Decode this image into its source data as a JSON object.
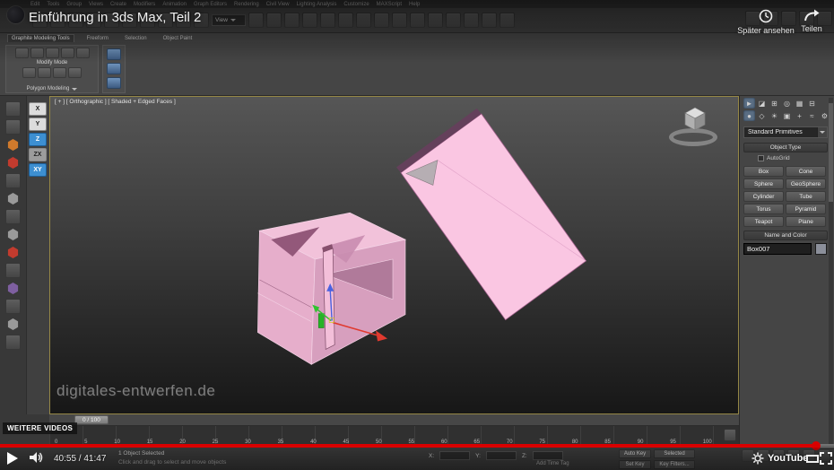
{
  "theme": {
    "yt_red": "#d90000",
    "object_pink": "#f2c2da",
    "object_pink_bright": "#fac6e2",
    "axis_blue": "#3d8fd1",
    "viewport_top": "#565656",
    "viewport_bottom": "#171717"
  },
  "player": {
    "title": "Einführung in 3ds Max, Teil 2",
    "watch_later_label": "Später ansehen",
    "share_label": "Teilen",
    "more_videos_label": "WEITERE VIDEOS",
    "time_display": "40:55 / 41:47",
    "progress_percent": 98,
    "brand": "YouTube"
  },
  "max_ui": {
    "menu_items": [
      "Edit",
      "Tools",
      "Group",
      "Views",
      "Create",
      "Modifiers",
      "Animation",
      "Graph Editors",
      "Rendering",
      "Civil View",
      "Lighting Analysis",
      "Customize",
      "MAXScript",
      "Help"
    ],
    "toolbar_view_label": "View",
    "ribbon_tabs": [
      "Graphite Modeling Tools",
      "Freeform",
      "Selection",
      "Object Paint"
    ],
    "modify_mode_label": "Modify Mode",
    "polygon_modeling_label": "Polygon Modeling",
    "viewport_label": "[ + ] [ Orthographic ] [ Shaded + Edged Faces ]",
    "axis_buttons": [
      "X",
      "Y",
      "Z",
      "ZX",
      "XY"
    ],
    "watermark": "digitales-entwerfen.de",
    "command_panel": {
      "category_dropdown": "Standard Primitives",
      "object_type_rollout": "Object Type",
      "autogrid_label": "AutoGrid",
      "primitive_buttons": [
        "Box",
        "Cone",
        "Sphere",
        "GeoSphere",
        "Cylinder",
        "Tube",
        "Torus",
        "Pyramid",
        "Teapot",
        "Plane"
      ],
      "name_color_rollout": "Name and Color",
      "object_name": "Box007"
    },
    "timeline": {
      "slider_label": "0 / 100",
      "ticks": [
        "0",
        "5",
        "10",
        "15",
        "20",
        "25",
        "30",
        "35",
        "40",
        "45",
        "50",
        "55",
        "60",
        "65",
        "70",
        "75",
        "80",
        "85",
        "90",
        "95",
        "100"
      ]
    },
    "status_bar": {
      "selection_status": "1 Object Selected",
      "hint": "Click and drag to select and move objects",
      "coord_labels": [
        "X:",
        "Y:",
        "Z:"
      ],
      "add_time_tag": "Add Time Tag",
      "auto_key": "Auto Key",
      "selected_mode": "Selected",
      "set_key": "Set Key",
      "key_filters": "Key Filters..."
    }
  }
}
